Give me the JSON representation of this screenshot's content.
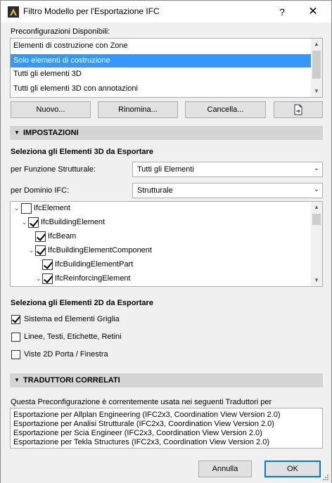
{
  "window": {
    "title": "Filtro Modello per l'Esportazione IFC",
    "help_label": "?",
    "close_label": "✕"
  },
  "presets": {
    "label": "Preconfigurazioni Disponibili:",
    "items": [
      "Elementi di costruzione con Zone",
      "Solo elementi di costruzione",
      "Tutti gli elementi 3D",
      "Tutti gli elementi 3D con annotazioni"
    ],
    "selected_index": 1,
    "new_label": "Nuovo...",
    "rename_label": "Rinomina...",
    "delete_label": "Cancella...",
    "export_icon": "export-file-icon"
  },
  "settings": {
    "header": "IMPOSTAZIONI",
    "select3d_label": "Seleziona gli Elementi 3D da Esportare",
    "structural_label": "per Funzione Strutturale:",
    "structural_value": "Tutti gli Elementi",
    "domain_label": "per Dominio IFC:",
    "domain_value": "Strutturale",
    "tree": [
      {
        "label": "IfcElement",
        "checked": false,
        "expanded": true
      },
      {
        "label": "IfcBuildingElement",
        "checked": true,
        "expanded": true
      },
      {
        "label": "IfcBeam",
        "checked": true,
        "expanded": null
      },
      {
        "label": "IfcBuildingElementComponent",
        "checked": true,
        "expanded": true
      },
      {
        "label": "IfcBuildingElementPart",
        "checked": true,
        "expanded": null
      },
      {
        "label": "IfcReinforcingElement",
        "checked": true,
        "expanded": true
      }
    ],
    "select2d_label": "Seleziona gli Elementi 2D da Esportare",
    "options2d": [
      {
        "label": "Sistema ed Elementi Griglia",
        "checked": true
      },
      {
        "label": "Linee, Testi, Etichette, Retini",
        "checked": false
      },
      {
        "label": "Viste 2D Porta / Finestra",
        "checked": false
      }
    ]
  },
  "translators": {
    "header": "TRADUTTORI CORRELATI",
    "description": "Questa Preconfigurazione è correntemente usata nei seguenti Traduttori per",
    "items": [
      "Esportazione per Allplan Engineering (IFC2x3, Coordination View Version 2.0)",
      "Esportazione per Analisi Strutturale (IFC2x3, Coordination View Version 2.0)",
      "Esportazione per Scia Engineer (IFC2x3, Coordination View Version 2.0)",
      "Esportazione per Tekla Structures (IFC2x3, Coordination View Version 2.0)"
    ]
  },
  "footer": {
    "cancel_label": "Annulla",
    "ok_label": "OK"
  },
  "colors": {
    "selection": "#3399ff",
    "section_bg": "#d4d4d4",
    "default_button_border": "#0078d7"
  }
}
